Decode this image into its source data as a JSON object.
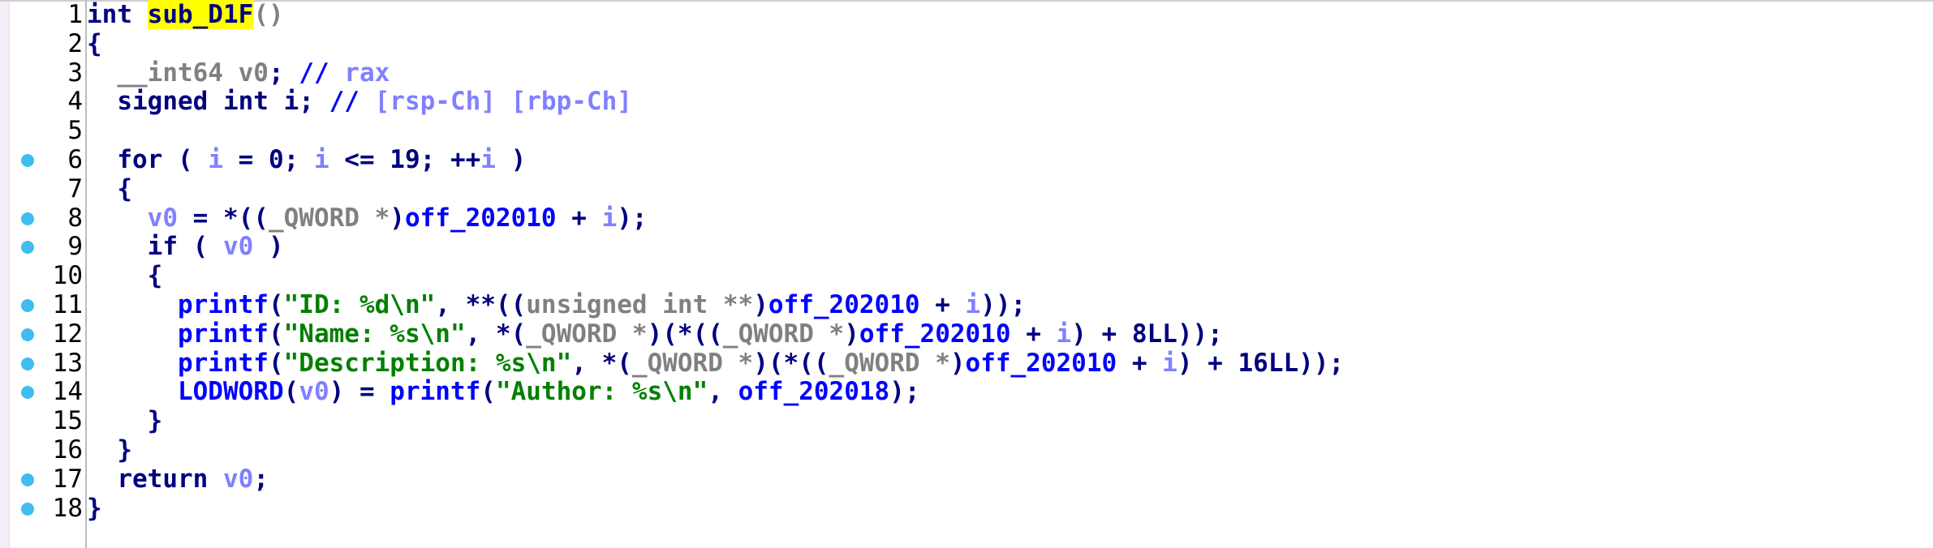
{
  "editor": {
    "function_name": "sub_D1F",
    "lines": [
      {
        "n": "1",
        "bp": false,
        "t": [
          [
            "kw",
            "int "
          ],
          [
            "hl",
            "sub_D1F"
          ],
          [
            "tp",
            "()"
          ]
        ]
      },
      {
        "n": "2",
        "bp": false,
        "t": [
          [
            "kw",
            "{"
          ]
        ]
      },
      {
        "n": "3",
        "bp": false,
        "t": [
          [
            "tp",
            "  __int64 v0"
          ],
          [
            "kw",
            "; "
          ],
          [
            "cm",
            "// "
          ],
          [
            "cmv",
            "rax"
          ]
        ]
      },
      {
        "n": "4",
        "bp": false,
        "t": [
          [
            "kw",
            "  signed int i; "
          ],
          [
            "cm",
            "// "
          ],
          [
            "cmv",
            "[rsp-Ch] [rbp-Ch]"
          ]
        ]
      },
      {
        "n": "5",
        "bp": false,
        "t": [
          [
            "kw",
            ""
          ]
        ]
      },
      {
        "n": "6",
        "bp": true,
        "t": [
          [
            "kw",
            "  for ( "
          ],
          [
            "var",
            "i"
          ],
          [
            "kw",
            " = 0; "
          ],
          [
            "var",
            "i"
          ],
          [
            "kw",
            " <= 19; ++"
          ],
          [
            "var",
            "i"
          ],
          [
            "kw",
            " )"
          ]
        ]
      },
      {
        "n": "7",
        "bp": false,
        "t": [
          [
            "kw",
            "  {"
          ]
        ]
      },
      {
        "n": "8",
        "bp": true,
        "t": [
          [
            "var",
            "    v0"
          ],
          [
            "kw",
            " = *(("
          ],
          [
            "tp",
            "_QWORD *"
          ],
          [
            "kw",
            ")"
          ],
          [
            "fn",
            "off_202010"
          ],
          [
            "kw",
            " + "
          ],
          [
            "var",
            "i"
          ],
          [
            "kw",
            ");"
          ]
        ]
      },
      {
        "n": "9",
        "bp": true,
        "t": [
          [
            "kw",
            "    if ( "
          ],
          [
            "var",
            "v0"
          ],
          [
            "kw",
            " )"
          ]
        ]
      },
      {
        "n": "10",
        "bp": false,
        "t": [
          [
            "kw",
            "    {"
          ]
        ]
      },
      {
        "n": "11",
        "bp": true,
        "t": [
          [
            "fn",
            "      printf"
          ],
          [
            "kw",
            "("
          ],
          [
            "str",
            "\"ID: %d\\n\""
          ],
          [
            "kw",
            ", **(("
          ],
          [
            "tp",
            "unsigned int **"
          ],
          [
            "kw",
            ")"
          ],
          [
            "fn",
            "off_202010"
          ],
          [
            "kw",
            " + "
          ],
          [
            "var",
            "i"
          ],
          [
            "kw",
            "));"
          ]
        ]
      },
      {
        "n": "12",
        "bp": true,
        "t": [
          [
            "fn",
            "      printf"
          ],
          [
            "kw",
            "("
          ],
          [
            "str",
            "\"Name: %s\\n\""
          ],
          [
            "kw",
            ", *("
          ],
          [
            "tp",
            "_QWORD *"
          ],
          [
            "kw",
            ")(*(("
          ],
          [
            "tp",
            "_QWORD *"
          ],
          [
            "kw",
            ")"
          ],
          [
            "fn",
            "off_202010"
          ],
          [
            "kw",
            " + "
          ],
          [
            "var",
            "i"
          ],
          [
            "kw",
            ") + 8LL));"
          ]
        ]
      },
      {
        "n": "13",
        "bp": true,
        "t": [
          [
            "fn",
            "      printf"
          ],
          [
            "kw",
            "("
          ],
          [
            "str",
            "\"Description: %s\\n\""
          ],
          [
            "kw",
            ", *("
          ],
          [
            "tp",
            "_QWORD *"
          ],
          [
            "kw",
            ")(*(("
          ],
          [
            "tp",
            "_QWORD *"
          ],
          [
            "kw",
            ")"
          ],
          [
            "fn",
            "off_202010"
          ],
          [
            "kw",
            " + "
          ],
          [
            "var",
            "i"
          ],
          [
            "kw",
            ") + 16LL));"
          ]
        ]
      },
      {
        "n": "14",
        "bp": true,
        "t": [
          [
            "fn",
            "      LODWORD"
          ],
          [
            "kw",
            "("
          ],
          [
            "var",
            "v0"
          ],
          [
            "kw",
            ") = "
          ],
          [
            "fn",
            "printf"
          ],
          [
            "kw",
            "("
          ],
          [
            "str",
            "\"Author: %s\\n\""
          ],
          [
            "kw",
            ", "
          ],
          [
            "fn",
            "off_202018"
          ],
          [
            "kw",
            ");"
          ]
        ]
      },
      {
        "n": "15",
        "bp": false,
        "t": [
          [
            "kw",
            "    }"
          ]
        ]
      },
      {
        "n": "16",
        "bp": false,
        "t": [
          [
            "kw",
            "  }"
          ]
        ]
      },
      {
        "n": "17",
        "bp": true,
        "t": [
          [
            "kw",
            "  return "
          ],
          [
            "var",
            "v0"
          ],
          [
            "kw",
            ";"
          ]
        ]
      },
      {
        "n": "18",
        "bp": true,
        "t": [
          [
            "kw",
            "}"
          ]
        ]
      }
    ]
  }
}
